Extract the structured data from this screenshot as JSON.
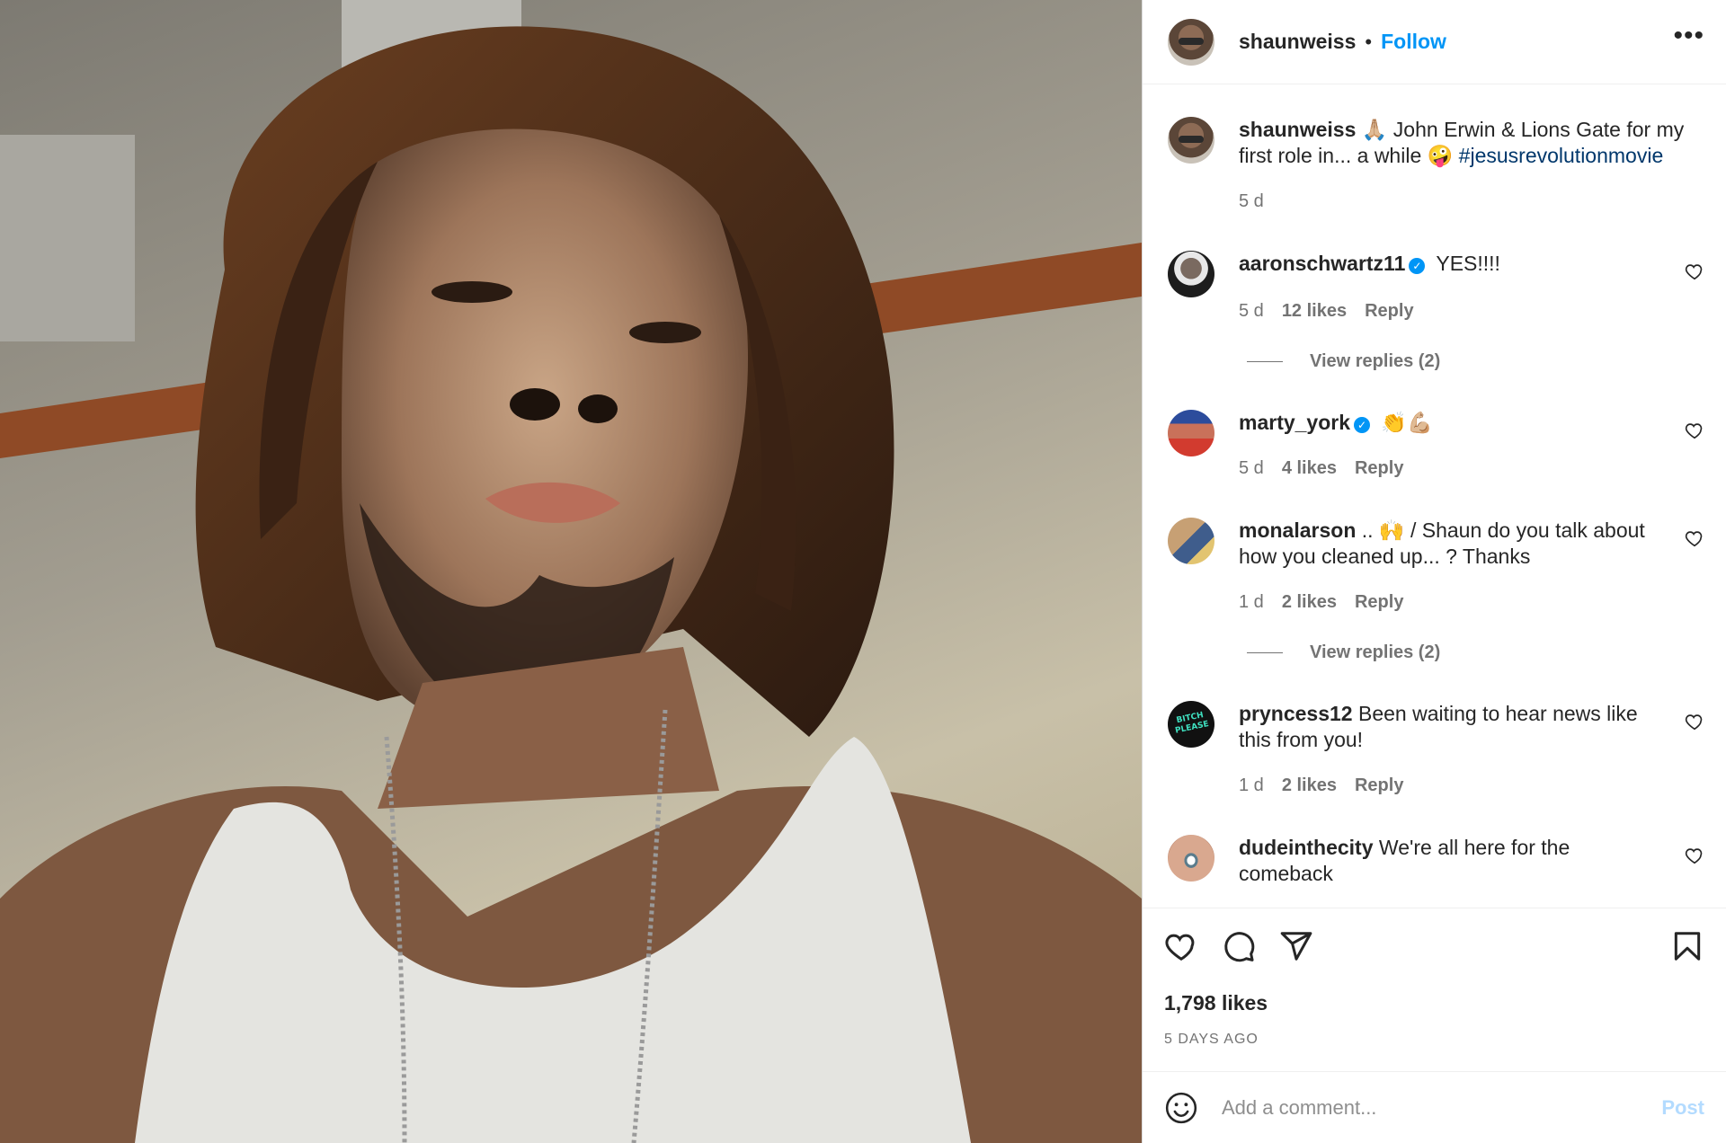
{
  "media": {
    "alt": ""
  },
  "header": {
    "username": "shaunweiss",
    "separator": "•",
    "follow_label": "Follow",
    "more_label": "•••"
  },
  "caption": {
    "username": "shaunweiss",
    "emoji_start": "🙏🏼",
    "text": " John Erwin & Lions Gate for my first role in... a while ",
    "emoji_end": "🤪",
    "hashtag": "#jesusrevolutionmovie",
    "time": "5 d"
  },
  "comments": [
    {
      "username": "aaronschwartz11",
      "verified": true,
      "text": " YES!!!!",
      "time": "5 d",
      "likes": "12 likes",
      "reply": "Reply",
      "view_replies": "View replies (2)"
    },
    {
      "username": "marty_york",
      "verified": true,
      "text": " 👏💪🏼",
      "time": "5 d",
      "likes": "4 likes",
      "reply": "Reply"
    },
    {
      "username": "monalarson",
      "verified": false,
      "text": " .. 🙌 / Shaun do you talk about how you cleaned up... ? Thanks",
      "time": "1 d",
      "likes": "2 likes",
      "reply": "Reply",
      "view_replies": "View replies (2)"
    },
    {
      "username": "pryncess12",
      "verified": false,
      "text": " Been waiting to hear news like this from you!",
      "time": "1 d",
      "likes": "2 likes",
      "reply": "Reply"
    },
    {
      "username": "dudeinthecity",
      "verified": false,
      "text": " We're all here for the comeback"
    }
  ],
  "verified_mark": "✓",
  "stats": {
    "likes": "1,798 likes",
    "ago": "5 DAYS AGO"
  },
  "add_comment": {
    "placeholder": "Add a comment...",
    "post_label": "Post"
  },
  "colors": {
    "accent": "#0095f6",
    "post_disabled": "#b3dbff",
    "hashtag": "#00376b"
  },
  "icons": [
    "heart-icon",
    "comment-icon",
    "share-icon",
    "bookmark-icon",
    "emoji-icon",
    "more-icon"
  ]
}
